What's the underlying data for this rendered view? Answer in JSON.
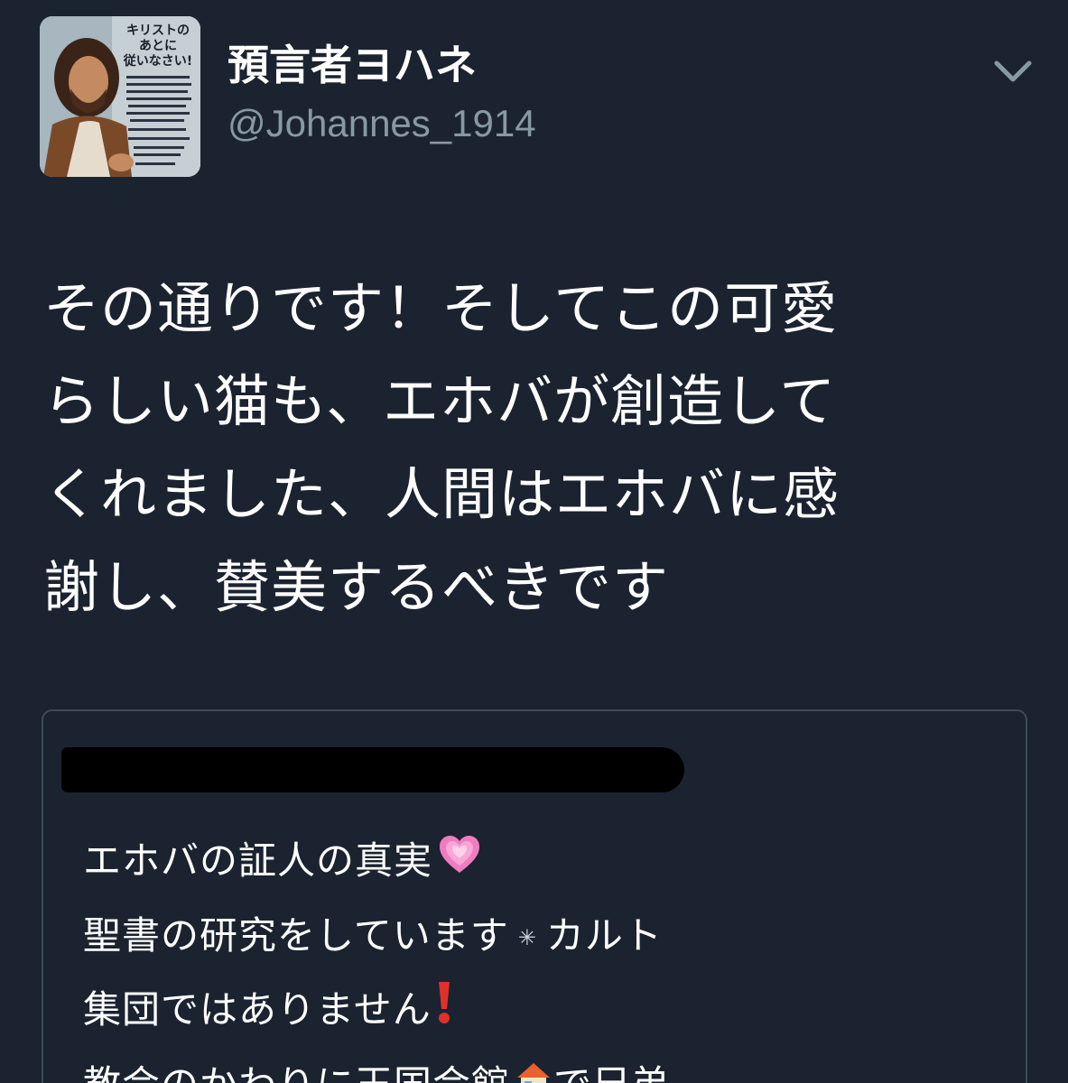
{
  "user": {
    "display_name": "預言者ヨハネ",
    "handle": "@Johannes_1914",
    "avatar_caption": "キリストの\nあとに\n従いなさい!"
  },
  "tweet": {
    "lines": [
      "その通りです！そしてこの可愛",
      "らしい猫も、エホバが創造して",
      "くれました、人間はエホバに感",
      "謝し、賛美するべきです"
    ]
  },
  "quoted": {
    "line1": "エホバの証人の真実",
    "line2a": "聖書の研究をしています",
    "line2_star": "✳",
    "line2b": "カルト",
    "line3": "集団ではありません",
    "line4a": "教会のかわりに王国会館",
    "line4b": "で兄弟"
  },
  "icons": {
    "menu": "chevron-down-icon",
    "heart": "growing-heart-icon",
    "exclamation": "red-exclamation-icon",
    "house": "house-icon"
  },
  "colors": {
    "background": "#1b2330",
    "secondary_text": "#8899a6",
    "card_border": "#3d4b5a"
  }
}
